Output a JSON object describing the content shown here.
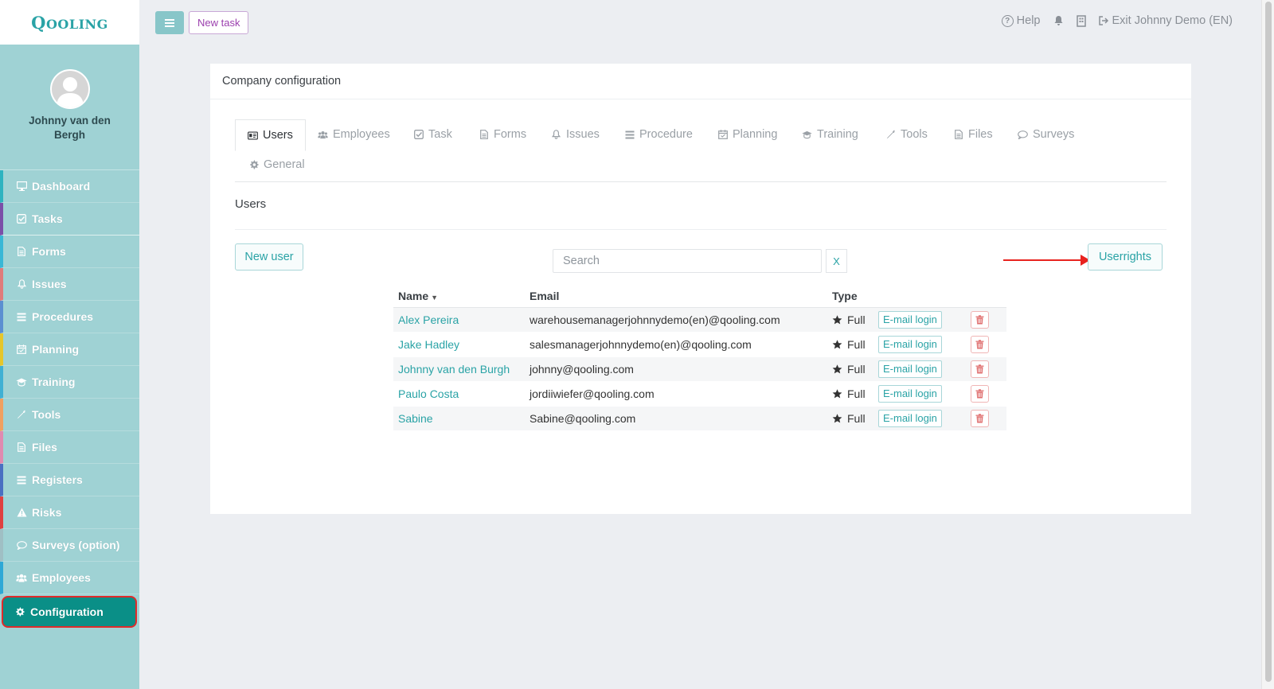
{
  "brand": {
    "logo_text": "QOOLING"
  },
  "user": {
    "name": "Johnny van den Bergh"
  },
  "sidebar": {
    "items": [
      {
        "label": "Dashboard",
        "icon": "monitor-icon",
        "color": "#2eb3c0"
      },
      {
        "label": "Tasks",
        "icon": "check-square-icon",
        "color": "#7b4fa8"
      },
      {
        "label": "Forms",
        "icon": "file-icon",
        "color": "#38b7d6"
      },
      {
        "label": "Issues",
        "icon": "bell-icon",
        "color": "#e07b7b"
      },
      {
        "label": "Procedures",
        "icon": "list-icon",
        "color": "#5b8fd1"
      },
      {
        "label": "Planning",
        "icon": "calendar-icon",
        "color": "#e6c62a"
      },
      {
        "label": "Training",
        "icon": "graduation-cap-icon",
        "color": "#3fb0d3"
      },
      {
        "label": "Tools",
        "icon": "wrench-icon",
        "color": "#f0a060"
      },
      {
        "label": "Files",
        "icon": "file-icon",
        "color": "#e08ab0"
      },
      {
        "label": "Registers",
        "icon": "list-icon",
        "color": "#4a6fc2"
      },
      {
        "label": "Risks",
        "icon": "warning-icon",
        "color": "#e04040"
      },
      {
        "label": "Surveys (option)",
        "icon": "comment-icon",
        "color": "#9fbfc4"
      },
      {
        "label": "Employees",
        "icon": "users-icon",
        "color": "#2ea8d6"
      },
      {
        "label": "Configuration",
        "icon": "gear-icon",
        "color": "#0a8f87"
      }
    ]
  },
  "topbar": {
    "new_task_label": "New task",
    "help_label": "Help",
    "exit_label": "Exit Johnny Demo (EN)"
  },
  "card": {
    "title": "Company configuration",
    "tabs": [
      {
        "label": "Users",
        "icon": "id-card-icon"
      },
      {
        "label": "Employees",
        "icon": "users-icon"
      },
      {
        "label": "Task",
        "icon": "check-square-icon"
      },
      {
        "label": "Forms",
        "icon": "file-icon"
      },
      {
        "label": "Issues",
        "icon": "bell-icon"
      },
      {
        "label": "Procedure",
        "icon": "list-icon"
      },
      {
        "label": "Planning",
        "icon": "calendar-icon"
      },
      {
        "label": "Training",
        "icon": "graduation-cap-icon"
      },
      {
        "label": "Tools",
        "icon": "wrench-icon"
      },
      {
        "label": "Files",
        "icon": "file-icon"
      },
      {
        "label": "Surveys",
        "icon": "comment-icon"
      },
      {
        "label": "General",
        "icon": "gear-icon"
      }
    ],
    "section_title": "Users",
    "new_user_label": "New user",
    "search_placeholder": "Search",
    "search_clear_label": "X",
    "userrights_label": "Userrights"
  },
  "users_table": {
    "headers": {
      "name": "Name",
      "email": "Email",
      "type": "Type"
    },
    "rows": [
      {
        "name": "Alex Pereira",
        "email": "warehousemanagerjohnnydemo(en)@qooling.com",
        "type": "Full",
        "login": "E-mail login"
      },
      {
        "name": "Jake Hadley",
        "email": "salesmanagerjohnnydemo(en)@qooling.com",
        "type": "Full",
        "login": "E-mail login"
      },
      {
        "name": "Johnny van den Burgh",
        "email": "johnny@qooling.com",
        "type": "Full",
        "login": "E-mail login"
      },
      {
        "name": "Paulo Costa",
        "email": "jordiiwiefer@qooling.com",
        "type": "Full",
        "login": "E-mail login"
      },
      {
        "name": "Sabine",
        "email": "Sabine@qooling.com",
        "type": "Full",
        "login": "E-mail login"
      }
    ]
  }
}
